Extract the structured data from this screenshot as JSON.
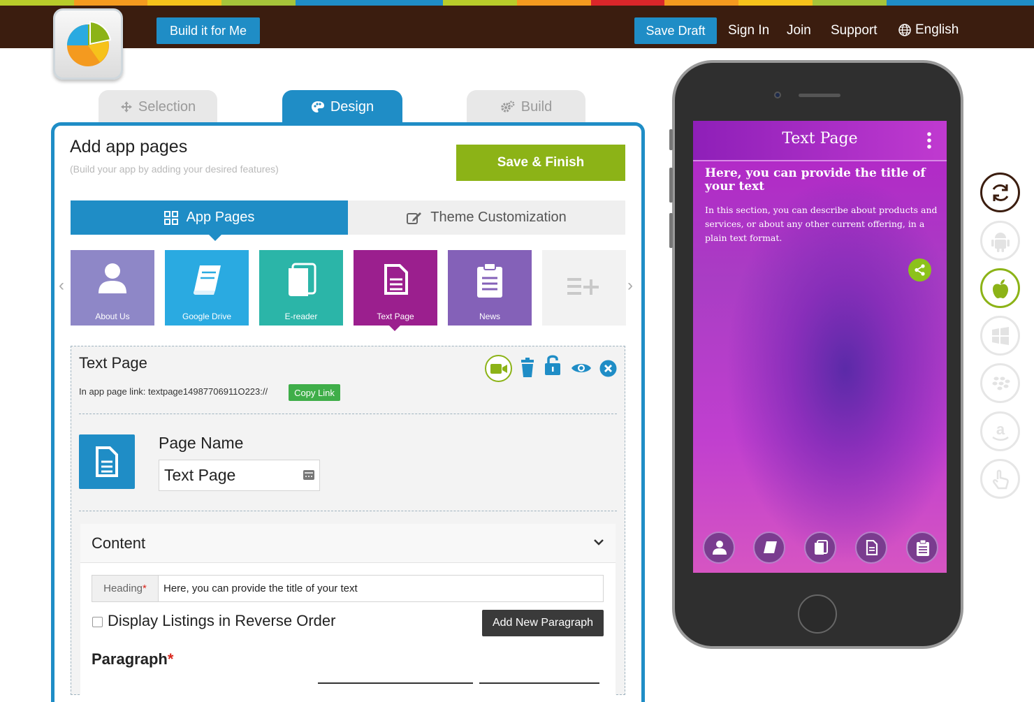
{
  "topbar": {
    "stripe_colors": [
      "#b8cc2a",
      "#f49a1f",
      "#f6c21b",
      "#a6c43a",
      "#1f8dc6",
      "#1f8dc6",
      "#b8cc2a",
      "#f49a1f",
      "#d9262a",
      "#f49a1f",
      "#f6c21b",
      "#a6c43a",
      "#1f8dc6",
      "#1f8dc6"
    ],
    "build_for_me": "Build it for Me",
    "save_draft": "Save Draft",
    "sign_in": "Sign In",
    "join": "Join",
    "support": "Support",
    "language": "English",
    "language_icon": "globe-icon"
  },
  "tabs": {
    "selection": "Selection",
    "design": "Design",
    "build": "Build"
  },
  "panel": {
    "title": "Add app pages",
    "subtitle": "(Build your app by adding your desired features)",
    "save_finish": "Save & Finish",
    "subtab_app_pages": "App Pages",
    "subtab_theme": "Theme Customization"
  },
  "tiles": [
    {
      "label": "About Us",
      "color": "#8e87c7",
      "icon": "person-icon"
    },
    {
      "label": "Google Drive",
      "color": "#2aaae1",
      "icon": "book-icon"
    },
    {
      "label": "E-reader",
      "color": "#2bb5a8",
      "icon": "pages-icon"
    },
    {
      "label": "Text Page",
      "color": "#9b1f8e",
      "icon": "document-icon"
    },
    {
      "label": "News",
      "color": "#8461b8",
      "icon": "clipboard-icon"
    }
  ],
  "editor": {
    "title": "Text Page",
    "link_text": "In app page link: textpage14987706911O223://",
    "copy_link": "Copy Link",
    "page_name_label": "Page Name",
    "page_name_value": "Text Page",
    "content_label": "Content",
    "heading_label": "Heading",
    "heading_required": "*",
    "heading_value": "Here, you can provide the title of your text",
    "reverse_order_label": "Display Listings in Reverse Order",
    "add_paragraph": "Add New Paragraph",
    "paragraph_label": "Paragraph",
    "paragraph_required": "*"
  },
  "phone": {
    "screen_title": "Text Page",
    "heading": "Here, you can provide the title of your text",
    "body": "In this section, you can describe about products and services, or about any other current offering, in a plain text format."
  },
  "platforms": [
    "refresh-icon",
    "android-icon",
    "apple-icon",
    "windows-icon",
    "blackberry-icon",
    "amazon-icon",
    "touch-icon"
  ]
}
